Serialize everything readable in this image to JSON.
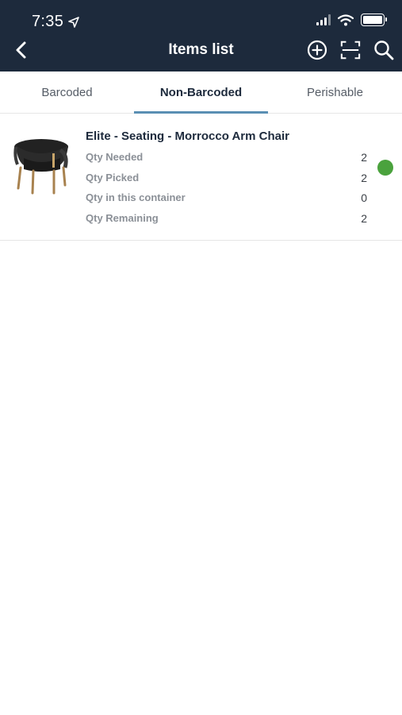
{
  "status_bar": {
    "time": "7:35"
  },
  "nav": {
    "title": "Items list"
  },
  "tabs": [
    {
      "label": "Barcoded",
      "active": false
    },
    {
      "label": "Non-Barcoded",
      "active": true
    },
    {
      "label": "Perishable",
      "active": false
    }
  ],
  "items": [
    {
      "title": "Elite - Seating - Morrocco Arm Chair",
      "rows": [
        {
          "label": "Qty Needed",
          "value": "2"
        },
        {
          "label": "Qty Picked",
          "value": "2"
        },
        {
          "label": "Qty in this container",
          "value": "0"
        },
        {
          "label": "Qty Remaining",
          "value": "2"
        }
      ],
      "status_color": "#4aa23d"
    }
  ],
  "colors": {
    "header_bg": "#1d2a3c",
    "tab_indicator": "#5a8fb3",
    "status_ok": "#4aa23d"
  }
}
